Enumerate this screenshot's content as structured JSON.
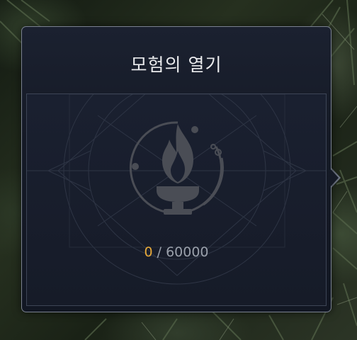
{
  "tooltip": {
    "title": "모험의 열기",
    "progress": {
      "current": "0",
      "separator": "/",
      "max": "60000"
    }
  },
  "colors": {
    "panel_background": "#151a26",
    "panel_border": "#7a8190",
    "title_text": "#e9eaec",
    "progress_current": "#e7a93a",
    "progress_text": "#9aa0ab",
    "emblem": "#4a4d55"
  },
  "icons": {
    "emblem": "flame-brazier-icon"
  }
}
